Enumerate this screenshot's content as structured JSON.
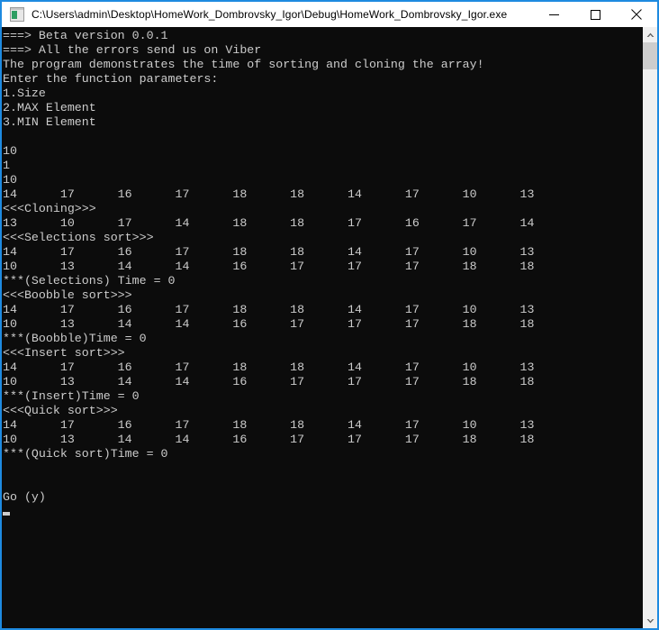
{
  "window": {
    "title": "C:\\Users\\admin\\Desktop\\HomeWork_Dombrovsky_Igor\\Debug\\HomeWork_Dombrovsky_Igor.exe",
    "icon": "console-app-icon",
    "border_color": "#1e8ae0",
    "titlebar_bg": "#ffffff",
    "console_bg": "#0c0c0c",
    "console_fg": "#cccccc",
    "controls": {
      "minimize_label": "Minimize",
      "maximize_label": "Maximize",
      "close_label": "Close"
    }
  },
  "scrollbar": {
    "up_arrow_label": "Scroll up",
    "down_arrow_label": "Scroll down",
    "thumb_label": "Scroll thumb",
    "track_color": "#f0f0f0",
    "thumb_color": "#cdcdcd"
  },
  "console": {
    "lines": [
      "===> Beta version 0.0.1",
      "===> All the errors send us on Viber",
      "The program demonstrates the time of sorting and cloning the array!",
      "Enter the function parameters:",
      "1.Size",
      "2.MAX Element",
      "3.MIN Element",
      "",
      "10",
      "1",
      "10",
      "14\t17\t16\t17\t18\t18\t14\t17\t10\t13",
      "<<<Cloning>>>",
      "13\t10\t17\t14\t18\t18\t17\t16\t17\t14",
      "<<<Selections sort>>>",
      "14\t17\t16\t17\t18\t18\t14\t17\t10\t13",
      "10\t13\t14\t14\t16\t17\t17\t17\t18\t18",
      "***(Selections) Time = 0",
      "<<<Boobble sort>>>",
      "14\t17\t16\t17\t18\t18\t14\t17\t10\t13",
      "10\t13\t14\t14\t16\t17\t17\t17\t18\t18",
      "***(Boobble)Time = 0",
      "<<<Insert sort>>>",
      "14\t17\t16\t17\t18\t18\t14\t17\t10\t13",
      "10\t13\t14\t14\t16\t17\t17\t17\t18\t18",
      "***(Insert)Time = 0",
      "<<<Quick sort>>>",
      "14\t17\t16\t17\t18\t18\t14\t17\t10\t13",
      "10\t13\t14\t14\t16\t17\t17\t17\t18\t18",
      "***(Quick sort)Time = 0",
      "",
      "",
      "Go (y)"
    ],
    "input_values": {
      "size": "10",
      "min_element": "1",
      "max_element": "10"
    },
    "prompt": "Go (y)",
    "cursor_visible": true
  }
}
